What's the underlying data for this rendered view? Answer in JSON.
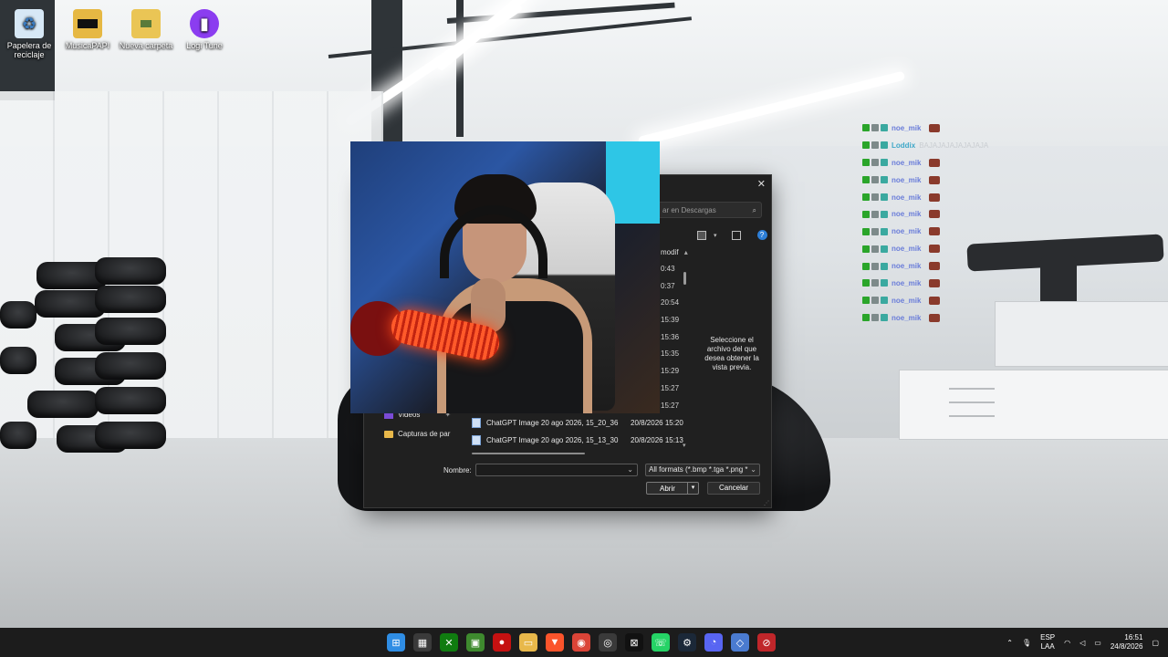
{
  "desktop": {
    "icons": [
      {
        "label": "Papelera de reciclaje",
        "icon": "recycle-bin-icon"
      },
      {
        "label": "MusicaPAPI",
        "icon": "folder-icon"
      },
      {
        "label": "Nueva carpeta",
        "icon": "folder-icon"
      },
      {
        "label": "Logi Tune",
        "icon": "logi-tune-icon"
      }
    ]
  },
  "dialog": {
    "search_placeholder": "ar en Descargas",
    "column_header": "modif",
    "dates": [
      "0:43",
      "0:37",
      "20:54",
      "15:39",
      "15:36",
      "15:35",
      "15:29",
      "15:27",
      "15:27"
    ],
    "preview_text": "Seleccione el archivo del que desea obtener la vista previa.",
    "nav": [
      {
        "label": "Videos"
      },
      {
        "label": "Capturas de par"
      }
    ],
    "files": [
      {
        "name": "ChatGPT Image 20 ago 2026, 15_20_36",
        "date": "20/8/2026 15:20"
      },
      {
        "name": "ChatGPT Image 20 ago 2026, 15_13_30",
        "date": "20/8/2026 15:13"
      }
    ],
    "filename_label": "Nombre:",
    "filename_value": "",
    "filetype": "All formats (*.bmp *.tga *.png *",
    "open_label": "Abrir",
    "cancel_label": "Cancelar"
  },
  "chat": {
    "messages": [
      {
        "user": "noe_mik",
        "color": "#6a7dd9",
        "text": ""
      },
      {
        "user": "Loddix",
        "color": "#3fa8c8",
        "text": "BAJAJAJAJAJAJAJA"
      },
      {
        "user": "noe_mik",
        "color": "#6a7dd9",
        "text": ""
      },
      {
        "user": "noe_mik",
        "color": "#6a7dd9",
        "text": ""
      },
      {
        "user": "noe_mik",
        "color": "#6a7dd9",
        "text": ""
      },
      {
        "user": "noe_mik",
        "color": "#6a7dd9",
        "text": ""
      },
      {
        "user": "noe_mik",
        "color": "#6a7dd9",
        "text": ""
      },
      {
        "user": "noe_mik",
        "color": "#6a7dd9",
        "text": ""
      },
      {
        "user": "noe_mik",
        "color": "#6a7dd9",
        "text": ""
      },
      {
        "user": "noe_mik",
        "color": "#6a7dd9",
        "text": ""
      },
      {
        "user": "noe_mik",
        "color": "#6a7dd9",
        "text": ""
      },
      {
        "user": "noe_mik",
        "color": "#6a7dd9",
        "text": ""
      }
    ]
  },
  "taskbar": {
    "apps": [
      {
        "name": "windows-start-icon",
        "color": "#2f8de4",
        "glyph": "⊞"
      },
      {
        "name": "store-icon",
        "color": "#3a3a3a",
        "glyph": "▦"
      },
      {
        "name": "xbox-icon",
        "color": "#107c10",
        "glyph": "✕"
      },
      {
        "name": "minecraft-icon",
        "color": "#3e8a2e",
        "glyph": "▣"
      },
      {
        "name": "among-us-icon",
        "color": "#c51111",
        "glyph": "●"
      },
      {
        "name": "file-explorer-icon",
        "color": "#e8b84a",
        "glyph": "▭"
      },
      {
        "name": "brave-icon",
        "color": "#fb542b",
        "glyph": "▼"
      },
      {
        "name": "chrome-icon",
        "color": "#db4437",
        "glyph": "◉"
      },
      {
        "name": "obs-icon",
        "color": "#3a3a3a",
        "glyph": "◎"
      },
      {
        "name": "capcut-icon",
        "color": "#111111",
        "glyph": "⊠"
      },
      {
        "name": "whatsapp-icon",
        "color": "#25d366",
        "glyph": "☏"
      },
      {
        "name": "steam-icon",
        "color": "#1b2838",
        "glyph": "⚙"
      },
      {
        "name": "discord-icon",
        "color": "#5865f2",
        "glyph": "◔"
      },
      {
        "name": "app-blue-icon",
        "color": "#4a7bd0",
        "glyph": "◇"
      },
      {
        "name": "red-app-icon",
        "color": "#c0262a",
        "glyph": "⊘"
      }
    ],
    "language": "ESP",
    "layout": "LAA",
    "time": "16:51",
    "date": "24/8/2026"
  }
}
